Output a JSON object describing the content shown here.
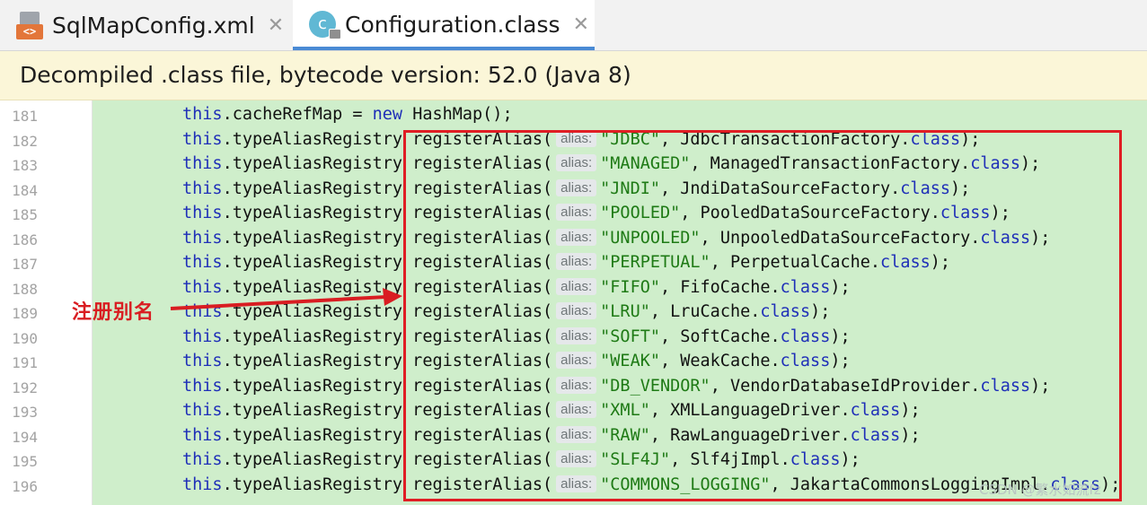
{
  "tabs": [
    {
      "label": "SqlMapConfig.xml",
      "icon": "xml-file-icon",
      "icon_text": "<>"
    },
    {
      "label": "Configuration.class",
      "icon": "class-file-icon",
      "icon_text": "c",
      "active": true
    }
  ],
  "close_glyph": "✕",
  "banner": {
    "text": "Decompiled .class file, bytecode version: 52.0 (Java 8)"
  },
  "editor": {
    "first_line": {
      "number": "181",
      "code": "this.cacheRefMap = new HashMap();"
    },
    "receiver": "this.typeAliasRegistry",
    "method": "registerAlias(",
    "hint_label": "alias:",
    "lines": [
      {
        "number": "182",
        "alias": "\"JDBC\"",
        "cls": "JdbcTransactionFactory"
      },
      {
        "number": "183",
        "alias": "\"MANAGED\"",
        "cls": "ManagedTransactionFactory"
      },
      {
        "number": "184",
        "alias": "\"JNDI\"",
        "cls": "JndiDataSourceFactory"
      },
      {
        "number": "185",
        "alias": "\"POOLED\"",
        "cls": "PooledDataSourceFactory"
      },
      {
        "number": "186",
        "alias": "\"UNPOOLED\"",
        "cls": "UnpooledDataSourceFactory"
      },
      {
        "number": "187",
        "alias": "\"PERPETUAL\"",
        "cls": "PerpetualCache"
      },
      {
        "number": "188",
        "alias": "\"FIFO\"",
        "cls": "FifoCache"
      },
      {
        "number": "189",
        "alias": "\"LRU\"",
        "cls": "LruCache"
      },
      {
        "number": "190",
        "alias": "\"SOFT\"",
        "cls": "SoftCache"
      },
      {
        "number": "191",
        "alias": "\"WEAK\"",
        "cls": "WeakCache"
      },
      {
        "number": "192",
        "alias": "\"DB_VENDOR\"",
        "cls": "VendorDatabaseIdProvider"
      },
      {
        "number": "193",
        "alias": "\"XML\"",
        "cls": "XMLLanguageDriver"
      },
      {
        "number": "194",
        "alias": "\"RAW\"",
        "cls": "RawLanguageDriver"
      },
      {
        "number": "195",
        "alias": "\"SLF4J\"",
        "cls": "Slf4jImpl"
      },
      {
        "number": "196",
        "alias": "\"COMMONS_LOGGING\"",
        "cls": "JakartaCommonsLoggingImpl"
      }
    ]
  },
  "annotation": {
    "text": "注册别名",
    "color": "#d91d22"
  },
  "watermark": "CSDN @繁水如流fz",
  "colors": {
    "keyword": "#1f2fb8",
    "string": "#1e7a15",
    "highlight": "#cfeecb",
    "accent": "#4a8ad4"
  }
}
